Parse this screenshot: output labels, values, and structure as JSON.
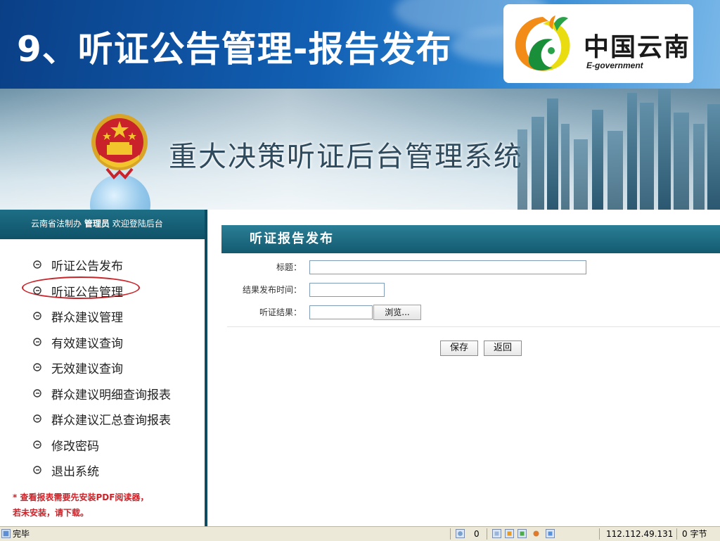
{
  "slide": {
    "title": "9、听证公告管理-报告发布",
    "brand_name": "中国云南",
    "brand_sub": "E-government"
  },
  "banner": {
    "system_title": "重大决策听证后台管理系统"
  },
  "sidebar": {
    "welcome_prefix": "云南省法制办",
    "user_role": "管理员",
    "welcome_suffix": "欢迎登陆后台",
    "items": [
      {
        "label": "听证公告发布"
      },
      {
        "label": "听证公告管理",
        "highlighted": true
      },
      {
        "label": "群众建议管理"
      },
      {
        "label": "有效建议查询"
      },
      {
        "label": "无效建议查询"
      },
      {
        "label": "群众建议明细查询报表"
      },
      {
        "label": "群众建议汇总查询报表"
      },
      {
        "label": "修改密码"
      },
      {
        "label": "退出系统"
      }
    ],
    "note_line1": "* 查看报表需要先安装PDF阅读器，",
    "note_line2": "若未安装，请下载。"
  },
  "form": {
    "section_title": "听证报告发布",
    "title_label": "标题：",
    "title_value": "",
    "time_label": "结果发布时间：",
    "time_value": "",
    "result_label": "听证结果：",
    "result_value": "",
    "browse_label": "浏览...",
    "save_label": "保存",
    "back_label": "返回"
  },
  "statusbar": {
    "status_text": "完毕",
    "count": "0",
    "ip": "112.112.49.131",
    "bytes": "0 字节"
  },
  "colors": {
    "header_teal": "#135a70",
    "highlight_red": "#c8242a",
    "slide_blue": "#1260b4"
  }
}
